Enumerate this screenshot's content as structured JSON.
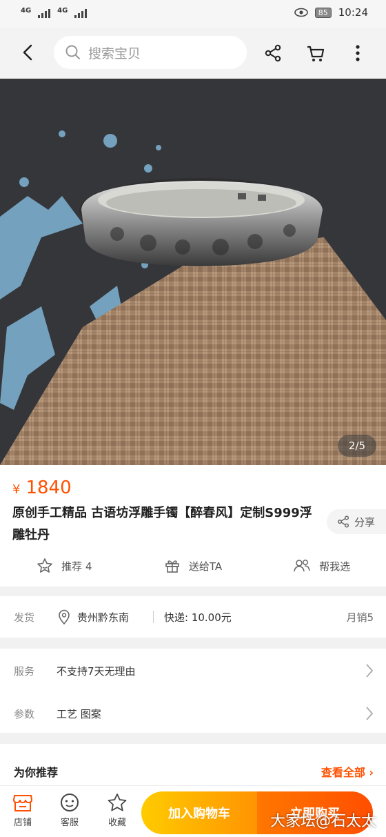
{
  "status": {
    "net1": "4G",
    "net2": "4G",
    "battery": "85",
    "time": "10:24"
  },
  "search": {
    "placeholder": "搜索宝贝"
  },
  "gallery": {
    "counter": "2/5"
  },
  "product": {
    "currency": "¥",
    "price": "1840",
    "title": "原创手工精品 古语坊浮雕手镯【醉春风】定制S999浮雕牡丹",
    "share_label": "分享"
  },
  "actions": {
    "recommend": "推荐 4",
    "gift": "送给TA",
    "help": "帮我选"
  },
  "shipping": {
    "label": "发货",
    "location": "贵州黔东南",
    "express": "快递: 10.00元",
    "monthly_sales": "月销5"
  },
  "service": {
    "label": "服务",
    "value": "不支持7天无理由"
  },
  "params": {
    "label": "参数",
    "value": "工艺 图案"
  },
  "recommend_section": {
    "title": "为你推荐",
    "more": "查看全部"
  },
  "bottom": {
    "shop": "店铺",
    "service": "客服",
    "favorite": "收藏",
    "add_cart": "加入购物车",
    "buy_now": "立即购买"
  },
  "watermark": "大家坛@石太太",
  "colors": {
    "accent": "#ff5000",
    "cart": "#ffb400",
    "buy": "#ff5a00"
  }
}
